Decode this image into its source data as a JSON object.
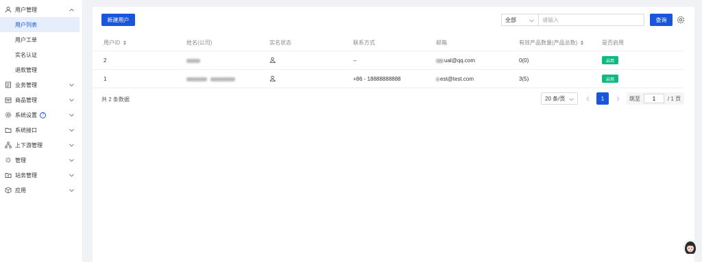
{
  "sidebar": {
    "user_mgmt": {
      "label": "用户管理",
      "icon": "user-icon"
    },
    "sub_items": [
      {
        "label": "用户列表",
        "active": true
      },
      {
        "label": "用户工单"
      },
      {
        "label": "实名认证"
      },
      {
        "label": "退款管理"
      }
    ],
    "items": [
      {
        "label": "业务管理",
        "icon": "document-icon"
      },
      {
        "label": "商品管理",
        "icon": "box-icon"
      },
      {
        "label": "系统设置",
        "icon": "gear-icon",
        "badge": "?"
      },
      {
        "label": "系统接口",
        "icon": "folder-icon"
      },
      {
        "label": "上下游管理",
        "icon": "hierarchy-icon"
      },
      {
        "label": "管理",
        "icon": "sparkle-icon"
      },
      {
        "label": "站务管理",
        "icon": "folder-plus-icon"
      },
      {
        "label": "应用",
        "icon": "cube-icon"
      }
    ]
  },
  "toolbar": {
    "new_user": "新建用户",
    "filter_value": "全部",
    "search_placeholder": "请输入",
    "query": "查询"
  },
  "table": {
    "headers": [
      "用户ID",
      "姓名(公司)",
      "实名状态",
      "联系方式",
      "邮箱",
      "有效产品数量(产品总数)",
      "是否启用"
    ],
    "rows": [
      {
        "id": "2",
        "contact": "--",
        "email": "ual@qq.com",
        "products": "0(0)",
        "enabled": "启用"
      },
      {
        "id": "1",
        "contact": "+86 - 18888888888",
        "email": "est@test.com",
        "products": "3(5)",
        "enabled": "启用"
      }
    ]
  },
  "footer": {
    "total": "共 2 条数据",
    "page_size": "20 条/页",
    "current_page": "1",
    "jump_label": "跳至",
    "jump_value": "1",
    "page_total": "/ 1 页"
  },
  "colors": {
    "primary": "#1a56db",
    "enabled_tag": "#10b981"
  }
}
